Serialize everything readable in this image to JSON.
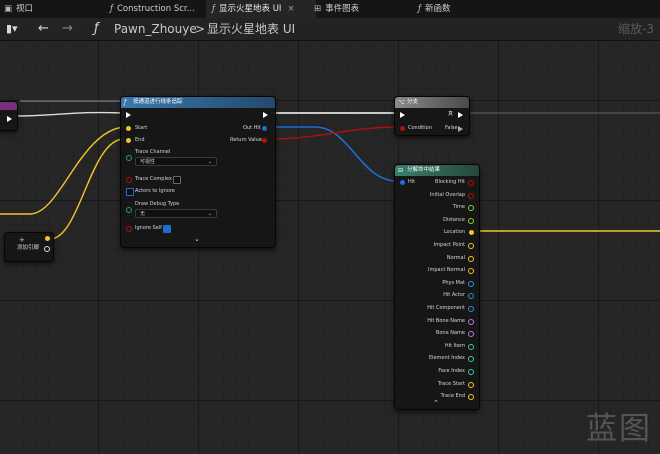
{
  "tabs": [
    {
      "label": "视口",
      "icon": "viewport-icon"
    },
    {
      "label": "Construction Scr...",
      "icon": "function-icon"
    },
    {
      "label": "显示火星地表 UI",
      "icon": "function-icon",
      "active": true
    },
    {
      "label": "事件图表",
      "icon": "event-graph-icon"
    },
    {
      "label": "新函数",
      "icon": "function-icon"
    }
  ],
  "toolbar": {
    "blueprint": "Pawn_Zhouye",
    "separator": ">",
    "function": "显示火星地表 UI",
    "zoom": "缩放-3"
  },
  "canvas": {
    "reroute_label": "添加引脚",
    "trace_node": {
      "title": "按通道进行线条追踪",
      "start": "Start",
      "end": "End",
      "trace_channel": "Trace Channel",
      "trace_channel_value": "可视性",
      "trace_complex": "Trace Complex",
      "actors_to_ignore": "Actors to Ignore",
      "draw_debug_type": "Draw Debug Type",
      "draw_debug_value": "无",
      "ignore_self": "Ignore Self",
      "out_hit": "Out Hit",
      "return_value": "Return Value"
    },
    "branch_node": {
      "title": "分支",
      "condition": "Condition",
      "true_label": "真",
      "false_label": "False"
    },
    "break_node": {
      "title": "分解命中结果",
      "hit": "Hit",
      "outputs": [
        "Blocking Hit",
        "Initial Overlap",
        "Time",
        "Distance",
        "Location",
        "Impact Point",
        "Normal",
        "Impact Normal",
        "Phys Mat",
        "Hit Actor",
        "Hit Component",
        "Hit Bone Name",
        "Bone Name",
        "Hit Item",
        "Element Index",
        "Face Index",
        "Trace Start",
        "Trace End"
      ]
    },
    "watermark": "蓝图"
  },
  "colors": {
    "exec": "#ffffff",
    "vector": "#f3c52a",
    "boolean": "#b10f0f",
    "struct": "#1c6fd1",
    "float": "#7fd63a",
    "trace_header": "#2d5f8c",
    "branch_header": "#6a6a6a",
    "break_header": "#2f6a5a"
  }
}
